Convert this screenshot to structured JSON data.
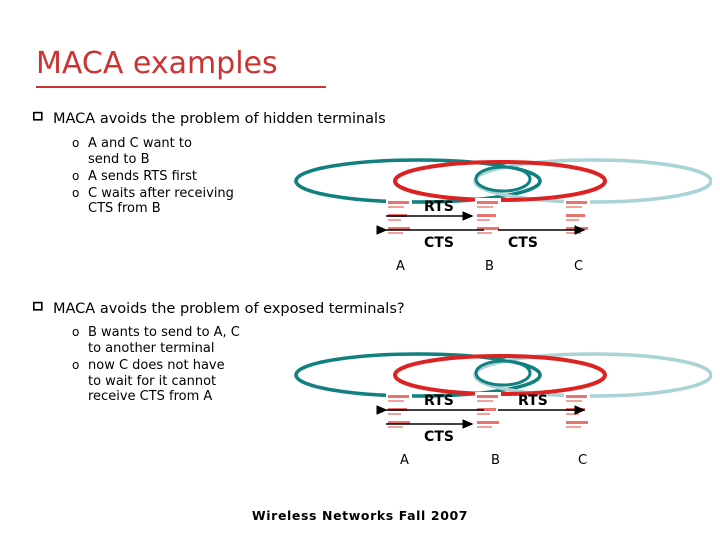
{
  "slide": {
    "title": "MACA examples",
    "title_color": "#cc3333",
    "footer": "Wireless Networks Fall 2007"
  },
  "sections": [
    {
      "heading": "MACA avoids the problem of hidden terminals",
      "marker": "q",
      "items": [
        {
          "marker": "o",
          "text": "A and C want to\nsend to B"
        },
        {
          "marker": "o",
          "text": "A sends RTS first"
        },
        {
          "marker": "o",
          "text": "C waits after receiving\nCTS from B"
        }
      ]
    },
    {
      "heading": "MACA avoids the problem of exposed terminals?",
      "marker": "q",
      "items": [
        {
          "marker": "o",
          "text": "B wants to send to A, C\nto another terminal"
        },
        {
          "marker": "o",
          "text": "now C does not have\nto wait for it cannot\nreceive CTS from A"
        }
      ]
    }
  ],
  "colors": {
    "range_a": "#12807f",
    "range_b": "#dd2222",
    "range_c": "#a9d3d6",
    "node_red": "#e8736f",
    "arrow": "#000000"
  },
  "diagrams": [
    {
      "name": "hidden-terminals",
      "nodes": [
        {
          "id": "A",
          "label": "A"
        },
        {
          "id": "B",
          "label": "B"
        },
        {
          "id": "C",
          "label": "C"
        }
      ],
      "messages": [
        {
          "label": "RTS",
          "from": "A",
          "to": "B",
          "direction": "right"
        },
        {
          "label": "CTS",
          "from": "B",
          "to": "A",
          "direction": "left"
        },
        {
          "label": "CTS",
          "from": "B",
          "to": "C",
          "direction": "right"
        }
      ]
    },
    {
      "name": "exposed-terminals",
      "nodes": [
        {
          "id": "A",
          "label": "A"
        },
        {
          "id": "B",
          "label": "B"
        },
        {
          "id": "C",
          "label": "C"
        }
      ],
      "messages": [
        {
          "label": "RTS",
          "from": "B",
          "to": "A",
          "direction": "left"
        },
        {
          "label": "RTS",
          "from": "B",
          "to": "C",
          "direction": "right"
        },
        {
          "label": "CTS",
          "from": "A",
          "to": "B",
          "direction": "right"
        }
      ]
    }
  ]
}
